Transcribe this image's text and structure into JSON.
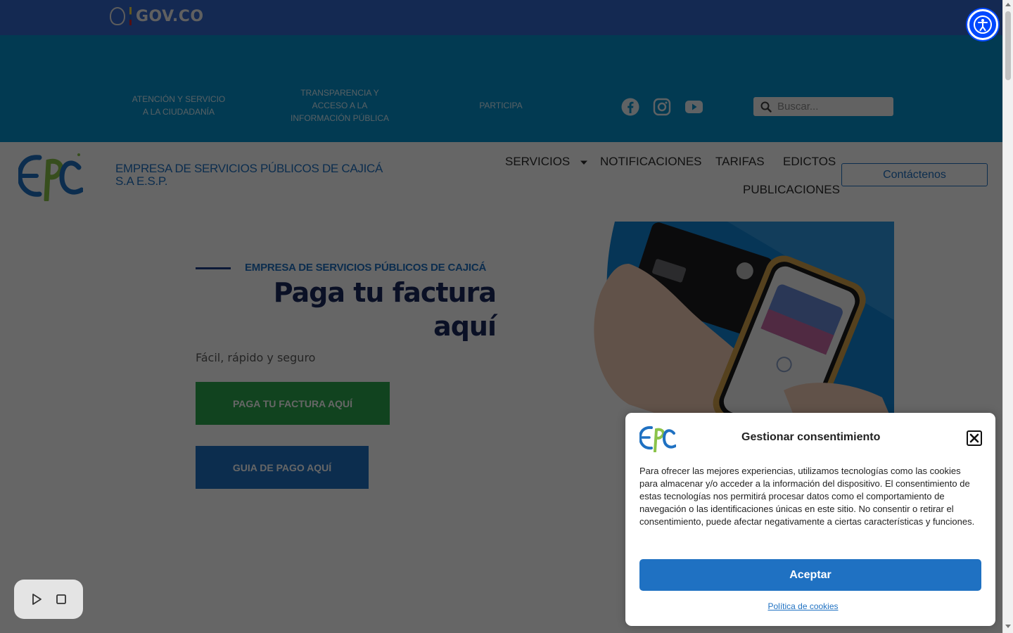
{
  "gov": {
    "brand": "GOV.CO"
  },
  "topnav": {
    "links": [
      {
        "label": "ATENCIÓN Y SERVICIO A LA CIUDADANÍA"
      },
      {
        "label": "TRANSPARENCIA Y ACCESO A LA INFORMACIÓN PÚBLICA"
      },
      {
        "label": "PARTICIPA"
      }
    ],
    "social": [
      "facebook-icon",
      "instagram-icon",
      "youtube-icon"
    ],
    "search_placeholder": "Buscar..."
  },
  "header": {
    "company": "EMPRESA DE SERVICIOS PÚBLICOS DE CAJICÁ S.A E.S.P.",
    "menu": {
      "servicios": "SERVICIOS",
      "notificaciones": "NOTIFICACIONES",
      "tarifas": "TARIFAS",
      "edictos": "EDICTOS",
      "publicaciones": "PUBLICACIONES"
    },
    "contact": "Contáctenos"
  },
  "hero": {
    "eyebrow": "EMPRESA DE SERVICIOS PÚBLICOS DE CAJICÁ",
    "headline": "Paga tu factura aquí",
    "subline": "Fácil, rápido y seguro",
    "pay_button": "PAGA TU FACTURA AQUÍ",
    "guide_button": "GUIA DE PAGO AQUÍ"
  },
  "cookie": {
    "title": "Gestionar consentimiento",
    "body": "Para ofrecer las mejores experiencias, utilizamos tecnologías como las cookies para almacenar y/o acceder a la información del dispositivo. El consentimiento de estas tecnologías nos permitirá procesar datos como el comportamiento de navegación o las identificaciones únicas en este sitio. No consentir o retirar el consentimiento, puede afectar negativamente a ciertas características y funciones.",
    "accept": "Aceptar",
    "policy": "Política de cookies"
  },
  "colors": {
    "gov_bar": "#3366cc",
    "topnav": "#0792cc",
    "brand_blue": "#1f71c2",
    "pay_green": "#2ca94e",
    "headline_navy": "#1a2a5e"
  }
}
